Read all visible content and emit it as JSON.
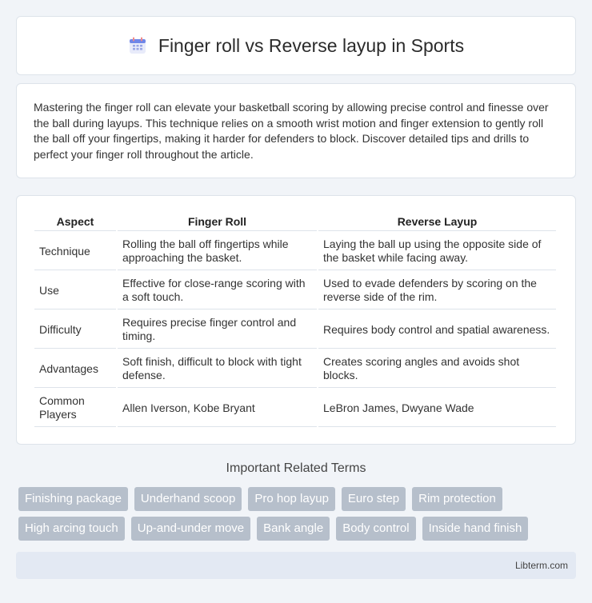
{
  "header": {
    "title": "Finger roll vs Reverse layup in Sports",
    "icon": "calendar-icon"
  },
  "intro": "Mastering the finger roll can elevate your basketball scoring by allowing precise control and finesse over the ball during layups. This technique relies on a smooth wrist motion and finger extension to gently roll the ball off your fingertips, making it harder for defenders to block. Discover detailed tips and drills to perfect your finger roll throughout the article.",
  "table": {
    "headers": [
      "Aspect",
      "Finger Roll",
      "Reverse Layup"
    ],
    "rows": [
      [
        "Technique",
        "Rolling the ball off fingertips while approaching the basket.",
        "Laying the ball up using the opposite side of the basket while facing away."
      ],
      [
        "Use",
        "Effective for close-range scoring with a soft touch.",
        "Used to evade defenders by scoring on the reverse side of the rim."
      ],
      [
        "Difficulty",
        "Requires precise finger control and timing.",
        "Requires body control and spatial awareness."
      ],
      [
        "Advantages",
        "Soft finish, difficult to block with tight defense.",
        "Creates scoring angles and avoids shot blocks."
      ],
      [
        "Common Players",
        "Allen Iverson, Kobe Bryant",
        "LeBron James, Dwyane Wade"
      ]
    ]
  },
  "related": {
    "title": "Important Related Terms",
    "tags": [
      "Finishing package",
      "Underhand scoop",
      "Pro hop layup",
      "Euro step",
      "Rim protection",
      "High arcing touch",
      "Up-and-under move",
      "Bank angle",
      "Body control",
      "Inside hand finish"
    ]
  },
  "footer": {
    "text": "Libterm.com"
  },
  "colors": {
    "tag_bg": "#b6bfcb",
    "footer_bg": "#e3e9f3",
    "page_bg": "#f1f4f8"
  }
}
